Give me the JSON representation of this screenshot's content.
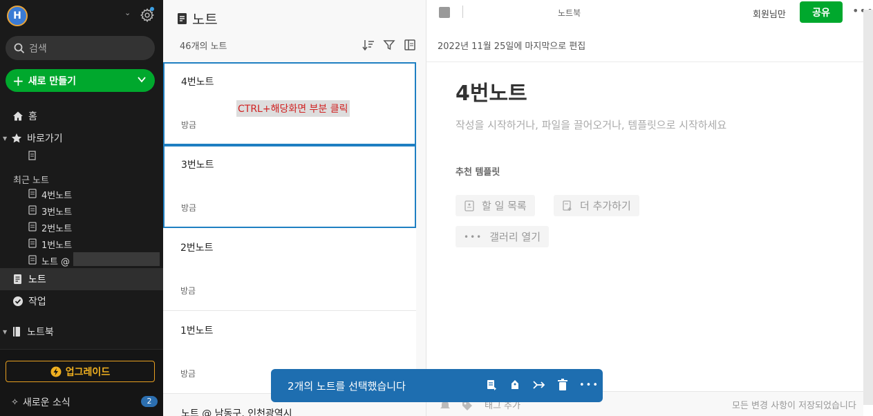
{
  "sidebar": {
    "avatar_letter": "H",
    "search_placeholder": "검색",
    "new_label": "새로 만들기",
    "home": "홈",
    "shortcuts": "바로가기",
    "recent_label": "최근 노트",
    "recent": [
      "4번노트",
      "3번노트",
      "2번노트",
      "1번노트",
      "노트 @"
    ],
    "notes": "노트",
    "tasks": "작업",
    "notebooks": "노트북",
    "upgrade": "업그레이드",
    "news": "새로운 소식",
    "news_count": "2"
  },
  "list": {
    "title": "노트",
    "count": "46개의 노트",
    "cards": [
      {
        "title": "4번노트",
        "date": "방금"
      },
      {
        "title": "3번노트",
        "date": "방금"
      },
      {
        "title": "2번노트",
        "date": "방금"
      },
      {
        "title": "1번노트",
        "date": "방금"
      }
    ],
    "hint": "CTRL+해당화면 부분 클릭",
    "partial": "노트 @ 남동구, 인천광역시"
  },
  "editor": {
    "notebook": "노트북",
    "members": "회원님만",
    "share": "공유",
    "edited": "2022년 11월 25일에 마지막으로 편집",
    "title": "4번노트",
    "placeholder": "작성을 시작하거나, 파일을 끌어오거나, 템플릿으로 시작하세요",
    "templates_label": "추천 템플릿",
    "templates": [
      "할 일 목록",
      "더 추가하기",
      "갤러리 열기"
    ],
    "tag": "태그 추가",
    "saved": "모든 변경 사항이 저장되었습니다"
  },
  "toast": {
    "message": "2개의 노트를 선택했습니다"
  },
  "colors": {
    "accent_green": "#00a82d",
    "selection_blue": "#1e7fc2",
    "toast_blue": "#1e6eb0",
    "upgrade_orange": "#e8a020"
  }
}
